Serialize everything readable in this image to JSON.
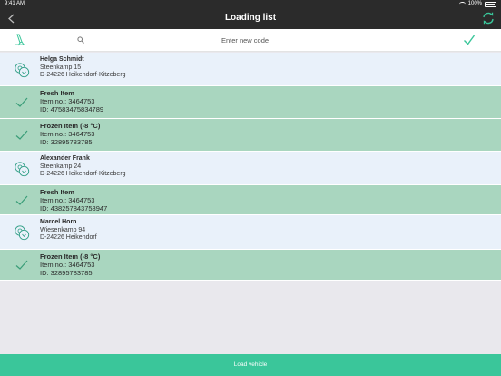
{
  "status": {
    "time": "9:41 AM",
    "battery": "100%"
  },
  "nav": {
    "title": "Loading list",
    "back_icon": "chevron-left-icon",
    "sync_icon": "sync-icon"
  },
  "search": {
    "placeholder": "Enter new code",
    "value": ""
  },
  "rows": [
    {
      "kind": "customer",
      "title": "Helga Schmidt",
      "line1": "Steenkamp 15",
      "line2": "D-24226 Heikendorf-Kitzeberg"
    },
    {
      "kind": "item",
      "title": "Fresh Item",
      "line1": "Item no.: 3464753",
      "line2": "ID: 47583475834789"
    },
    {
      "kind": "item",
      "title": "Frozen Item (-8 °C)",
      "line1": "Item no.: 3464753",
      "line2": "ID: 32895783785"
    },
    {
      "kind": "customer",
      "title": "Alexander Frank",
      "line1": "Steenkamp 24",
      "line2": "D-24226 Heikendorf-Kitzeberg"
    },
    {
      "kind": "item",
      "title": "Fresh Item",
      "line1": "Item no.: 3464753",
      "line2": "ID: 438257843758947"
    },
    {
      "kind": "customer",
      "title": "Marcel Horn",
      "line1": "Wiesenkamp 94",
      "line2": "D-24226 Heikendorf"
    },
    {
      "kind": "item",
      "title": "Frozen Item (-8 °C)",
      "line1": "Item no.: 3464753",
      "line2": "ID: 32895783785"
    }
  ],
  "footer": {
    "label": "Load vehicle"
  },
  "colors": {
    "accent": "#3ac69a",
    "item_row": "#a9d6bf",
    "customer_row": "#e9f1fa",
    "navbar": "#2b2b2b"
  }
}
